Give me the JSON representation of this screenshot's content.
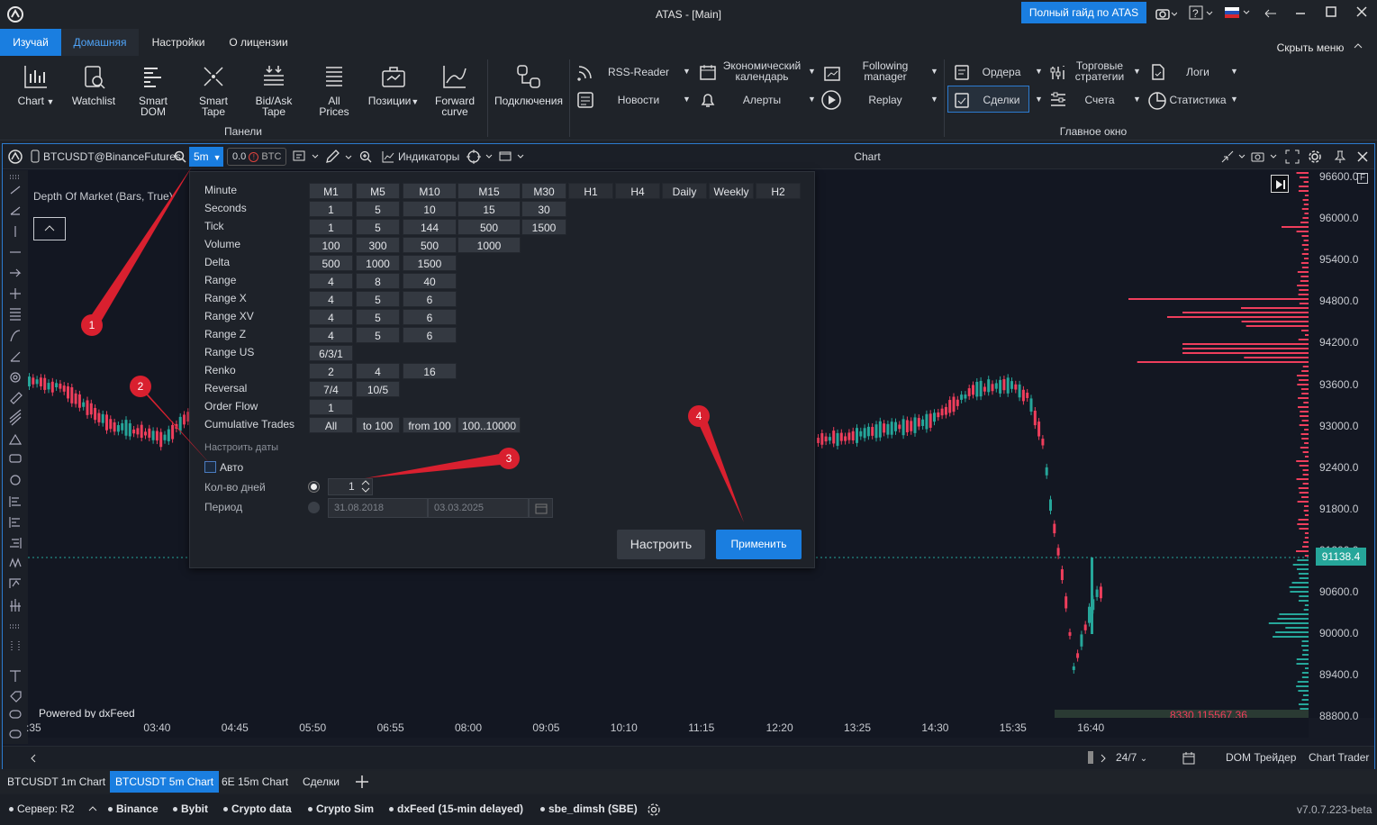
{
  "window": {
    "title": "ATAS - [Main]",
    "guide_button": "Полный гайд по ATAS"
  },
  "ribbon": {
    "tabs": [
      "Изучай",
      "Домашняя",
      "Настройки",
      "О лицензии"
    ],
    "hide_menu": "Скрыть меню",
    "panels_group": "Панели",
    "main_window_group": "Главное окно",
    "buttons": {
      "chart": "Chart",
      "watchlist": "Watchlist",
      "smart_dom_1": "Smart",
      "smart_dom_2": "DOM",
      "smart_tape_1": "Smart",
      "smart_tape_2": "Tape",
      "bidask_1": "Bid/Ask",
      "bidask_2": "Tape",
      "allprices_1": "All",
      "allprices_2": "Prices",
      "positions": "Позиции",
      "forward_1": "Forward",
      "forward_2": "curve",
      "connections": "Подключения",
      "rss": "RSS-Reader",
      "news": "Новости",
      "calendar_1": "Экономический",
      "calendar_2": "календарь",
      "alerts": "Алерты",
      "following_1": "Following",
      "following_2": "manager",
      "replay": "Replay",
      "orders": "Ордера",
      "deals": "Сделки",
      "strategies_1": "Торговые",
      "strategies_2": "стратегии",
      "accounts": "Счета",
      "logs": "Логи",
      "statistics": "Статистика"
    }
  },
  "chart": {
    "instrument": "BTCUSDT@BinanceFutures",
    "timeframe": "5m",
    "position": "0.0",
    "position_unit": "BTC",
    "indicators": "Индикаторы",
    "title": "Chart",
    "dom_label": "Depth Of Market (Bars, True)",
    "powered": "Powered by dxFeed",
    "current_price": "91138.4",
    "volume_readout": "8330,115567,36",
    "session": "24/7",
    "dom_trader": "DOM Трейдер",
    "chart_trader": "Chart Trader",
    "y_labels": [
      "96600.0",
      "96000.0",
      "95400.0",
      "94800.0",
      "94200.0",
      "93600.0",
      "93000.0",
      "92400.0",
      "91800.0",
      "91200.0",
      "90600.0",
      "90000.0",
      "89400.0",
      "88800.0"
    ],
    "x_labels": [
      ":35",
      "03:40",
      "04:45",
      "05:50",
      "06:55",
      "08:00",
      "09:05",
      "10:10",
      "11:15",
      "12:20",
      "13:25",
      "14:30",
      "15:35",
      "16:40"
    ]
  },
  "popup": {
    "rows": [
      {
        "label": "Minute",
        "values": [
          "M1",
          "M5",
          "M10",
          "M15",
          "M30",
          "H1",
          "H4",
          "Daily",
          "Weekly",
          "H2"
        ]
      },
      {
        "label": "Seconds",
        "values": [
          "1",
          "5",
          "10",
          "15",
          "30"
        ]
      },
      {
        "label": "Tick",
        "values": [
          "1",
          "5",
          "144",
          "500",
          "1500"
        ]
      },
      {
        "label": "Volume",
        "values": [
          "100",
          "300",
          "500",
          "1000"
        ]
      },
      {
        "label": "Delta",
        "values": [
          "500",
          "1000",
          "1500"
        ]
      },
      {
        "label": "Range",
        "values": [
          "4",
          "8",
          "40"
        ]
      },
      {
        "label": "Range X",
        "values": [
          "4",
          "5",
          "6"
        ]
      },
      {
        "label": "Range XV",
        "values": [
          "4",
          "5",
          "6"
        ]
      },
      {
        "label": "Range Z",
        "values": [
          "4",
          "5",
          "6"
        ]
      },
      {
        "label": "Range US",
        "values": [
          "6/3/1"
        ]
      },
      {
        "label": "Renko",
        "values": [
          "2",
          "4",
          "16"
        ]
      },
      {
        "label": "Reversal",
        "values": [
          "7/4",
          "10/5"
        ]
      },
      {
        "label": "Order Flow",
        "values": [
          "1"
        ]
      },
      {
        "label": "Cumulative Trades",
        "values": [
          "All",
          "to 100",
          "from 100",
          "100..10000"
        ]
      }
    ],
    "dates_header": "Настроить даты",
    "auto_label": "Авто",
    "days_label": "Кол-во дней",
    "days_value": "1",
    "period_label": "Период",
    "date_from": "31.08.2018",
    "date_to": "03.03.2025",
    "configure_button": "Настроить",
    "apply_button": "Применить"
  },
  "markers": [
    "1",
    "2",
    "3",
    "4"
  ],
  "bottom_tabs": [
    "BTCUSDT 1m Chart",
    "BTCUSDT 5m Chart",
    "6E 15m Chart",
    "Сделки"
  ],
  "status": {
    "server": "Сервер: R2",
    "connections": [
      "Binance",
      "Bybit",
      "Crypto data",
      "Crypto Sim",
      "dxFeed (15-min delayed)",
      "sbe_dimsh (SBE)"
    ],
    "version": "v7.0.7.223-beta"
  },
  "colors": {
    "accent": "#1a7ee0",
    "bull": "#26a69a",
    "bear": "#ef3e5c",
    "marker": "#d9202f"
  }
}
